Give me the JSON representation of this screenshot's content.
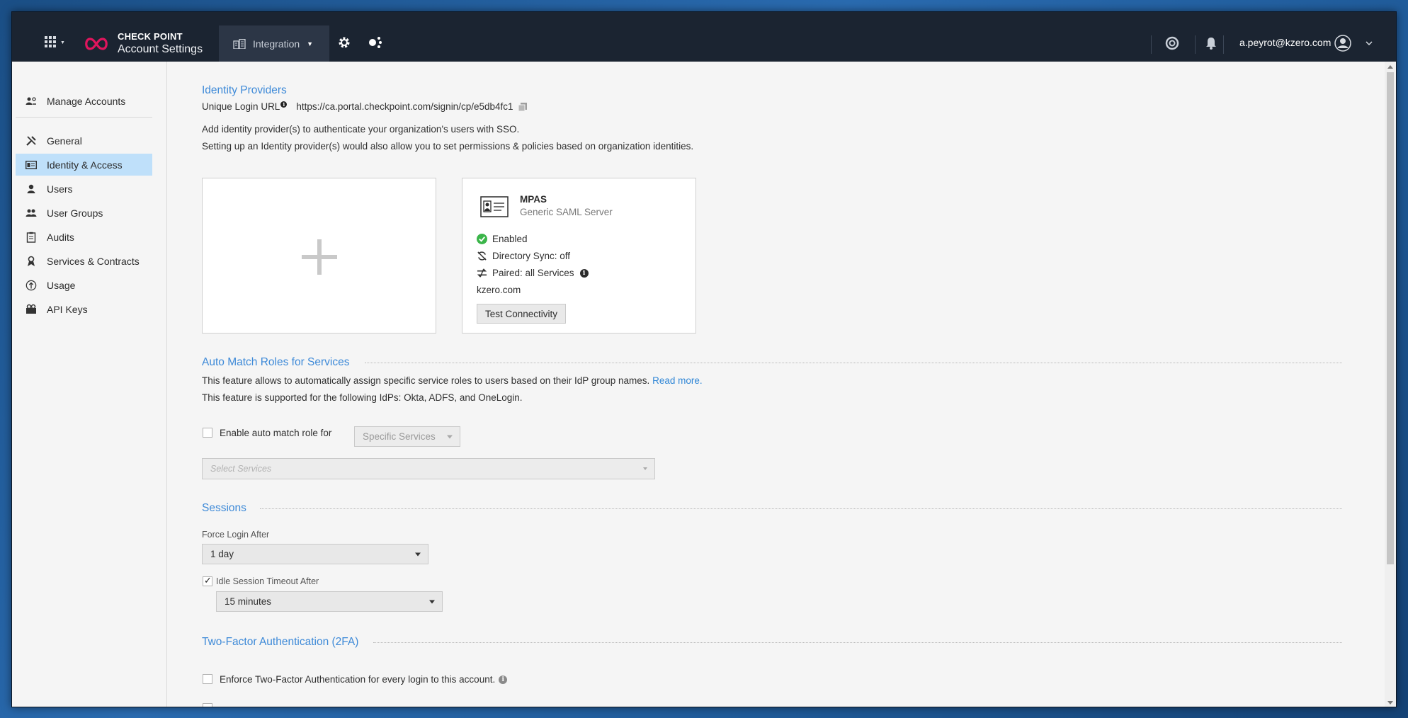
{
  "brand": {
    "line1": "CHECK POINT",
    "line2": "Account Settings",
    "accent": "#e0155d"
  },
  "topbar": {
    "integration_label": "Integration",
    "user_email": "a.peyrot@kzero.com"
  },
  "sidebar": {
    "items": [
      {
        "label": "Manage Accounts",
        "icon": "manage-accounts-icon"
      },
      {
        "label": "General",
        "icon": "tools-icon"
      },
      {
        "label": "Identity & Access",
        "icon": "id-card-icon",
        "active": true
      },
      {
        "label": "Users",
        "icon": "user-icon"
      },
      {
        "label": "User Groups",
        "icon": "user-groups-icon"
      },
      {
        "label": "Audits",
        "icon": "clipboard-icon"
      },
      {
        "label": "Services & Contracts",
        "icon": "services-icon"
      },
      {
        "label": "Usage",
        "icon": "gauge-icon"
      },
      {
        "label": "API Keys",
        "icon": "keys-icon"
      }
    ]
  },
  "identity": {
    "title": "Identity Providers",
    "login_url_label": "Unique Login URL",
    "login_url": "https://ca.portal.checkpoint.com/signin/cp/e5db4fc1",
    "desc1": "Add identity provider(s) to authenticate your organization's users with SSO.",
    "desc2": "Setting up an Identity provider(s) would also allow you to set permissions & policies based on organization identities.",
    "provider": {
      "name": "MPAS",
      "type": "Generic SAML Server",
      "status": "Enabled",
      "directory_sync": "Directory Sync: off",
      "paired": "Paired: all Services",
      "domain": "kzero.com",
      "test_button": "Test Connectivity"
    }
  },
  "auto_match": {
    "title": "Auto Match Roles for Services",
    "desc1": "This feature allows to automatically assign specific service roles to users based on their IdP group names.",
    "read_more": "Read more.",
    "desc2": "This feature is supported for the following IdPs: Okta, ADFS, and OneLogin.",
    "enable_label": "Enable auto match role for",
    "services_select": "Specific Services",
    "select_placeholder": "Select Services"
  },
  "sessions": {
    "title": "Sessions",
    "force_login_label": "Force Login After",
    "force_login_value": "1 day",
    "idle_label": "Idle Session Timeout After",
    "idle_checked": true,
    "idle_value": "15 minutes"
  },
  "twofa": {
    "title": "Two-Factor Authentication (2FA)",
    "enforce_label": "Enforce Two-Factor Authentication for every login to this account."
  }
}
